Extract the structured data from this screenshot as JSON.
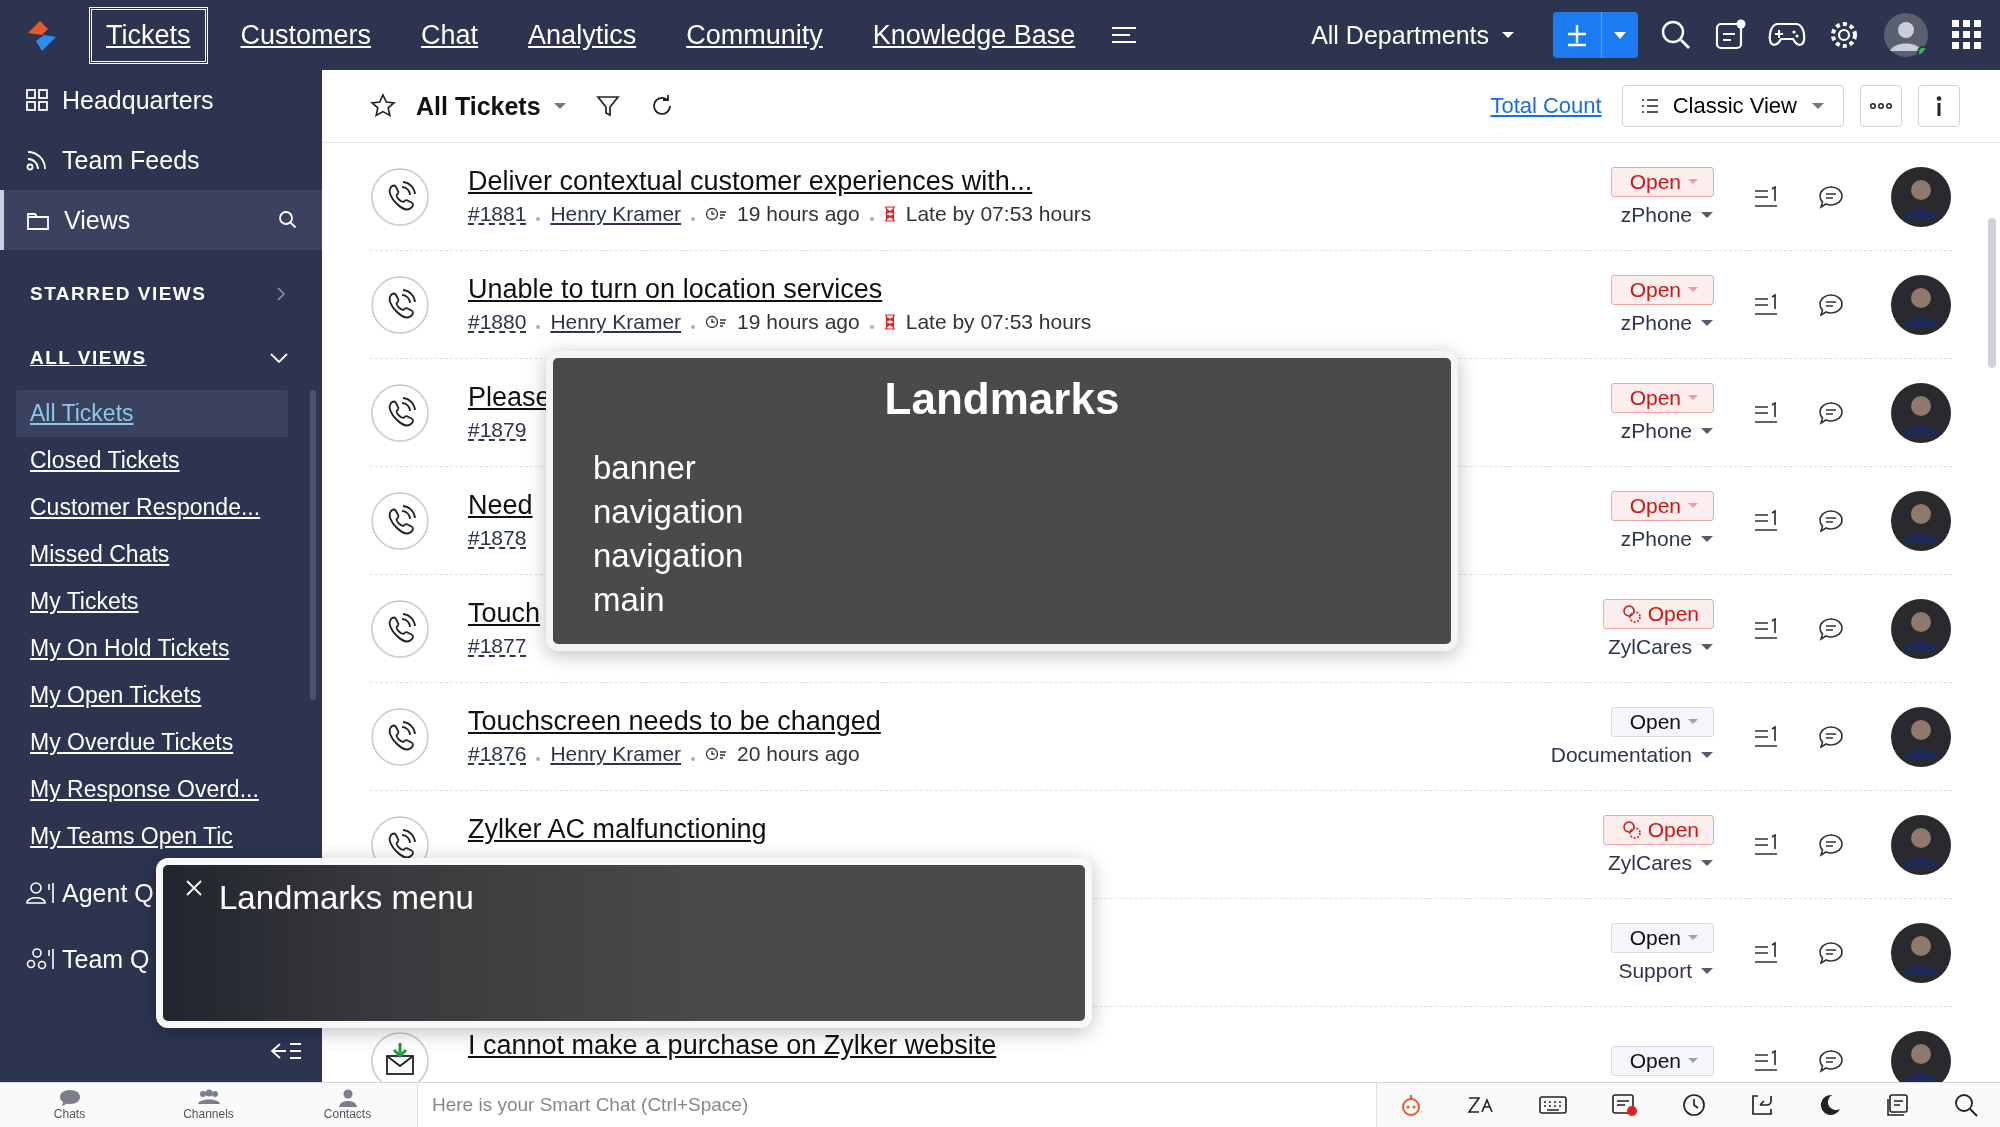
{
  "top_nav": {
    "tabs": [
      {
        "label": "Tickets",
        "selected": true
      },
      {
        "label": "Customers",
        "selected": false
      },
      {
        "label": "Chat",
        "selected": false
      },
      {
        "label": "Analytics",
        "selected": false
      },
      {
        "label": "Community",
        "selected": false
      },
      {
        "label": "Knowledge Base",
        "selected": false
      }
    ],
    "department": "All Departments"
  },
  "sidebar": {
    "items": [
      {
        "label": "Headquarters",
        "kind": "grid",
        "selected": false
      },
      {
        "label": "Team Feeds",
        "kind": "feed",
        "selected": false
      },
      {
        "label": "Views",
        "kind": "folder",
        "selected": true
      }
    ],
    "starred_views": {
      "label": "STARRED VIEWS",
      "expanded": false
    },
    "all_views": {
      "label": "ALL VIEWS",
      "expanded": true,
      "items": [
        {
          "label": "All Tickets",
          "selected": true
        },
        {
          "label": "Closed Tickets",
          "selected": false
        },
        {
          "label": "Customer Responde...",
          "selected": false
        },
        {
          "label": "Missed Chats",
          "selected": false
        },
        {
          "label": "My Tickets",
          "selected": false
        },
        {
          "label": "My On Hold Tickets",
          "selected": false
        },
        {
          "label": "My Open Tickets",
          "selected": false
        },
        {
          "label": "My Overdue Tickets",
          "selected": false
        },
        {
          "label": "My Response Overd...",
          "selected": false
        },
        {
          "label": "My Teams Open Tic",
          "selected": false
        }
      ]
    },
    "queues": [
      {
        "label": "Agent Q",
        "kind": "agent"
      },
      {
        "label": "Team Q",
        "kind": "team"
      }
    ]
  },
  "toolbar": {
    "view_title": "All Tickets",
    "total_count": "Total Count",
    "view_mode": "Classic View"
  },
  "tickets": [
    {
      "kind": "phone",
      "title": "Deliver contextual customer experiences with...",
      "id": "#1881",
      "contact": "Henry Kramer",
      "time": "19 hours ago",
      "late": "Late by 07:53 hours",
      "status": "Open",
      "overdue": true,
      "blueprint": false,
      "department": "zPhone"
    },
    {
      "kind": "phone",
      "title": "Unable to turn on location services",
      "id": "#1880",
      "contact": "Henry Kramer",
      "time": "19 hours ago",
      "late": "Late by 07:53 hours",
      "status": "Open",
      "overdue": true,
      "blueprint": false,
      "department": "zPhone"
    },
    {
      "kind": "phone",
      "title": "Please",
      "id": "#1879",
      "status": "Open",
      "overdue": true,
      "blueprint": false,
      "department": "zPhone"
    },
    {
      "kind": "phone",
      "title": "Need",
      "id": "#1878",
      "status": "Open",
      "overdue": true,
      "blueprint": false,
      "department": "zPhone"
    },
    {
      "kind": "phone",
      "title": "Touch",
      "id": "#1877",
      "status": "Open",
      "overdue": true,
      "blueprint": true,
      "department": "ZylCares"
    },
    {
      "kind": "phone",
      "title": "Touchscreen needs to be changed",
      "id": "#1876",
      "contact": "Henry Kramer",
      "time": "20 hours ago",
      "status": "Open",
      "overdue": false,
      "blueprint": false,
      "department": "Documentation"
    },
    {
      "kind": "phone",
      "title": "Zylker AC malfunctioning",
      "status": "Open",
      "overdue": true,
      "blueprint": true,
      "department": "ZylCares"
    },
    {
      "kind": "unknown",
      "status": "Open",
      "overdue": false,
      "blueprint": false,
      "department": "Support"
    },
    {
      "kind": "email",
      "title": "I cannot make a purchase on Zylker website",
      "status": "Open",
      "overdue": false,
      "blueprint": false
    }
  ],
  "bottom_bar": {
    "apps": [
      "Chats",
      "Channels",
      "Contacts"
    ],
    "smart_chat_placeholder": "Here is your Smart Chat (Ctrl+Space)"
  },
  "landmarks_popup": {
    "title": "Landmarks",
    "items": [
      "banner",
      "navigation",
      "navigation",
      "main"
    ]
  },
  "landmarks_menu": {
    "title": "Landmarks menu"
  }
}
